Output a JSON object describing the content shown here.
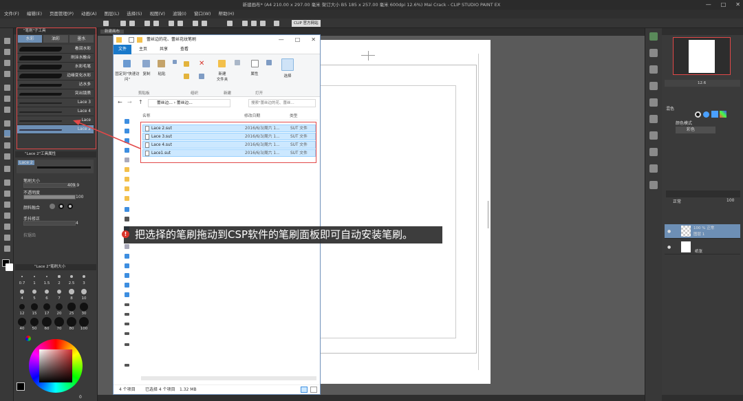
{
  "window": {
    "title": "新建画布* (A4 210.00 x 297.00 毫米 架订大小 B5 185 x 257.00 毫米 600dpi 12.6%)   Mai Crack - CLIP STUDIO PAINT EX",
    "minimize": "—",
    "maximize": "□",
    "close": "✕"
  },
  "menu": [
    "文件(F)",
    "编辑(E)",
    "页面管理(P)",
    "动画(A)",
    "图层(L)",
    "选择(S)",
    "视图(V)",
    "滤镜(I)",
    "窗口(W)",
    "帮助(H)"
  ],
  "toolbar": {
    "clip_badge": "CLIP 官方网站"
  },
  "sub_tool_panel": {
    "header": "\"笔刷\"子工具",
    "tabs": [
      "水彩",
      "油彩",
      "墨水"
    ],
    "brushes": [
      {
        "name": "看润水彩",
        "selected": false
      },
      {
        "name": "刷涂水融合",
        "selected": false
      },
      {
        "name": "水彩毛笔",
        "selected": false
      },
      {
        "name": "边缘变化水彩",
        "selected": false
      },
      {
        "name": "达水多",
        "selected": false
      },
      {
        "name": "突出镜质",
        "selected": false
      },
      {
        "name": "Lace 3",
        "selected": false
      },
      {
        "name": "Lace 4",
        "selected": false
      },
      {
        "name": "Lace",
        "selected": false
      },
      {
        "name": "Lace 2",
        "selected": true
      }
    ]
  },
  "tool_property": {
    "header": "\"Lace 2\"工具属性",
    "preset_name": "Lace 2",
    "brush_size_label": "笔刷大小",
    "brush_size_value": "409.9",
    "opacity_label": "不透明度",
    "opacity_value": "100",
    "blend_label": "颜料融合",
    "stabilize_label": "手抖修正",
    "stabilize_value": "4",
    "anti_alias_label": "抗锯齿"
  },
  "brush_size_panel": {
    "header": "\"Lace 2\"笔刷大小",
    "sizes": [
      "0.7",
      "1",
      "1.5",
      "2",
      "2.5",
      "3",
      "4",
      "5",
      "6",
      "7",
      "8",
      "10",
      "12",
      "15",
      "17",
      "20",
      "25",
      "30",
      "40",
      "50",
      "60",
      "70",
      "80",
      "100"
    ]
  },
  "color_panel": {
    "value": "0"
  },
  "document_tab": "新建画布",
  "explorer": {
    "title": "蕾丝边的花、蕾丝花纹笔刷",
    "tabs": {
      "file": "文件",
      "home": "主页",
      "share": "共享",
      "view": "查看"
    },
    "ribbon": {
      "pin": "固定到\"快速访问\"",
      "copy": "复制",
      "paste": "粘贴",
      "move": "",
      "delete": "",
      "new_folder": "新建\n文件夹",
      "properties": "属性",
      "select": "选择",
      "groups": {
        "clipboard": "剪贴板",
        "organize": "组织",
        "new": "新建",
        "open": "打开"
      }
    },
    "address": "蕾丝边...  ›  蕾丝边...",
    "search_placeholder": "搜索\"蕾丝边的花、蕾丝...",
    "columns": {
      "name": "名称",
      "date": "修改日期",
      "type": "类型"
    },
    "files": [
      {
        "name": "Lace 2.sut",
        "date": "2016/6/3/周六 1...",
        "type": "SUT 文件"
      },
      {
        "name": "Lace 3.sut",
        "date": "2016/6/3/周六 1...",
        "type": "SUT 文件"
      },
      {
        "name": "Lace 4.sut",
        "date": "2016/6/3/周六 1...",
        "type": "SUT 文件"
      },
      {
        "name": "Lace1.sut",
        "date": "2016/6/3/周六 1...",
        "type": "SUT 文件"
      }
    ],
    "status": {
      "count": "4 个项目",
      "selected": "已选择 4 个项目",
      "size": "1.32 MB"
    }
  },
  "caption": "把选择的笔刷拖动到CSP软件的笔刷面板即可自动安装笔刷。",
  "right_panel": {
    "navigator_zoom": "12.6",
    "sub_view_label": "混色",
    "blend_mode_label": "颜色模式",
    "blend_mode_value": "彩色",
    "layer_blend": "正常",
    "layer_opacity": "100",
    "layers": [
      {
        "name": "100 % 正常",
        "sub": "图层 1",
        "selected": true
      },
      {
        "name": "纸张",
        "sub": "",
        "selected": false
      }
    ]
  },
  "colors": {
    "accent_red": "#e24848",
    "selection_blue": "#cce8ff",
    "brush_selected": "#6d8fb5"
  }
}
